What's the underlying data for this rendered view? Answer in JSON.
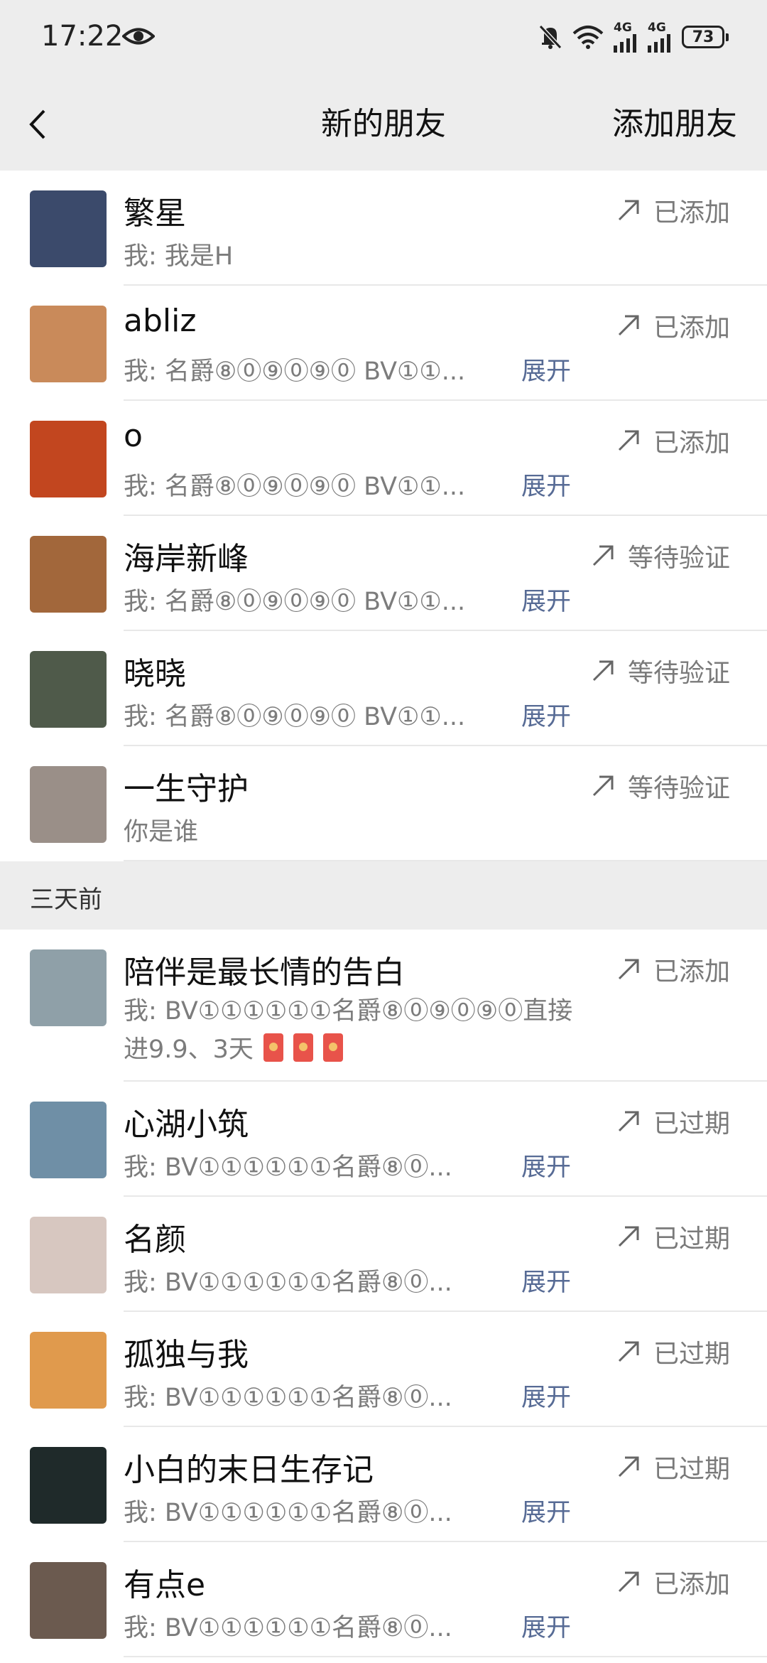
{
  "status_bar": {
    "time": "17:22",
    "signal1": "4G",
    "signal2": "4G",
    "battery": "73",
    "icons": [
      "eye-icon",
      "mute-bell-icon",
      "wifi-icon",
      "signal-icon",
      "battery-icon"
    ]
  },
  "nav": {
    "title": "新的朋友",
    "action": "添加朋友"
  },
  "section_label": "三天前",
  "colors": {
    "background_gray": "#ededed",
    "link_blue": "#576b95",
    "secondary_text": "#7c7c7c"
  },
  "recent": [
    {
      "name": "繁星",
      "message": "我: 我是H",
      "expand": "",
      "status": "已添加",
      "avatar_color": "#3b4a6b"
    },
    {
      "name": "abliz",
      "message": "我: 名爵⑧⓪⑨⓪⑨⓪ BV①①...",
      "expand": "展开",
      "status": "已添加",
      "avatar_color": "#c98a5a"
    },
    {
      "name": "o",
      "message": "我: 名爵⑧⓪⑨⓪⑨⓪ BV①①...",
      "expand": "展开",
      "status": "已添加",
      "avatar_color": "#c2461f"
    },
    {
      "name": "海岸新峰",
      "message": "我: 名爵⑧⓪⑨⓪⑨⓪ BV①①...",
      "expand": "展开",
      "status": "等待验证",
      "avatar_color": "#a2673b"
    },
    {
      "name": "晓晓",
      "message": "我: 名爵⑧⓪⑨⓪⑨⓪ BV①①...",
      "expand": "展开",
      "status": "等待验证",
      "avatar_color": "#4f5a4a"
    },
    {
      "name": "一生守护",
      "message": "你是谁",
      "expand": "",
      "status": "等待验证",
      "avatar_color": "#9a8f88"
    }
  ],
  "earlier": [
    {
      "name": "陪伴是最长情的告白",
      "message": "我: BV①①①①①①名爵⑧⓪⑨⓪⑨⓪直接进9.9、3天",
      "expand": "",
      "status": "已添加",
      "avatar_color": "#8fa0a8"
    },
    {
      "name": "心湖小筑",
      "message": "我: BV①①①①①①名爵⑧⓪...",
      "expand": "展开",
      "status": "已过期",
      "avatar_color": "#6f8fa6"
    },
    {
      "name": "名颜",
      "message": "我: BV①①①①①①名爵⑧⓪...",
      "expand": "展开",
      "status": "已过期",
      "avatar_color": "#d7c7c0"
    },
    {
      "name": "孤独与我",
      "message": "我: BV①①①①①①名爵⑧⓪...",
      "expand": "展开",
      "status": "已过期",
      "avatar_color": "#e09a4d"
    },
    {
      "name": "小白的末日生存记",
      "message": "我: BV①①①①①①名爵⑧⓪...",
      "expand": "展开",
      "status": "已过期",
      "avatar_color": "#1f2a2a"
    },
    {
      "name": "有点e",
      "message": "我: BV①①①①①①名爵⑧⓪...",
      "expand": "展开",
      "status": "已添加",
      "avatar_color": "#6b5a4f"
    }
  ]
}
